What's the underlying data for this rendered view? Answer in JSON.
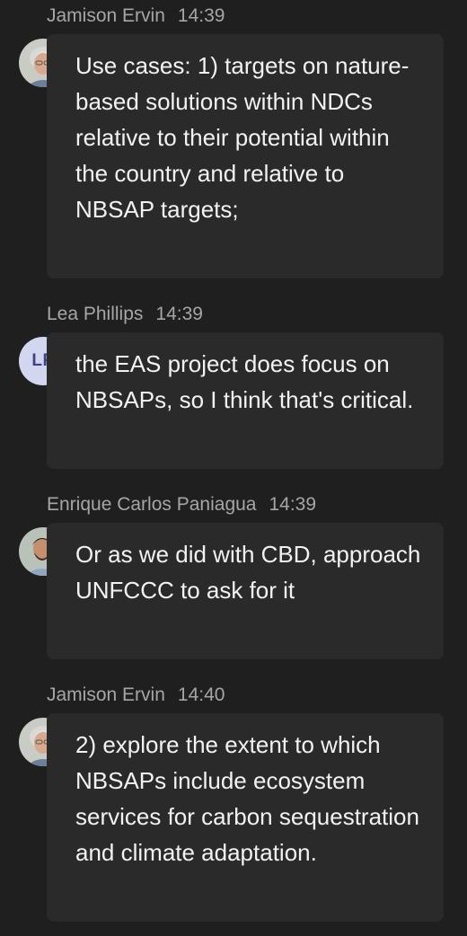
{
  "messages": [
    {
      "author": "Jamison Ervin",
      "time": "14:39",
      "text": "Use cases: 1) targets on nature-based solutions within NDCs relative to their potential within the country and relative to NBSAP targets;",
      "avatar": {
        "kind": "photo",
        "icon": "avatar-photo"
      },
      "presence": "busy"
    },
    {
      "author": "Lea Phillips",
      "time": "14:39",
      "text": "the EAS project does focus on NBSAPs, so I think that's critical.",
      "avatar": {
        "kind": "initials",
        "initials": "LP"
      },
      "presence": "busy-outline"
    },
    {
      "author": "Enrique Carlos Paniagua",
      "time": "14:39",
      "text": "Or as we did with CBD, approach UNFCCC to ask for it",
      "avatar": {
        "kind": "photo",
        "icon": "avatar-photo"
      },
      "presence": "busy"
    },
    {
      "author": "Jamison Ervin",
      "time": "14:40",
      "text": "2) explore the extent to which NBSAPs include ecosystem services for carbon sequestration and climate adaptation.",
      "avatar": {
        "kind": "photo",
        "icon": "avatar-photo"
      },
      "presence": "busy"
    }
  ],
  "colors": {
    "background": "#1f1f1f",
    "bubble": "#2a2a2a",
    "text": "#f2f2f2",
    "meta": "#a6a6a6",
    "presence_busy": "#e0383f"
  }
}
